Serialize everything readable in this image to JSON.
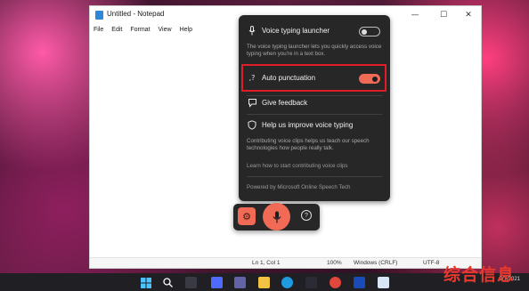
{
  "notepad": {
    "title": "Untitled - Notepad",
    "window_buttons": {
      "minimize": "—",
      "maximize": "☐",
      "close": "✕"
    },
    "menu": [
      "File",
      "Edit",
      "Format",
      "View",
      "Help"
    ],
    "status": {
      "position": "Ln 1, Col 1",
      "zoom": "100%",
      "line_ending": "Windows (CRLF)",
      "encoding": "UTF-8"
    }
  },
  "voice_typing_panel": {
    "launcher": {
      "label": "Voice typing launcher",
      "enabled": false
    },
    "launcher_desc": "The voice typing launcher lets you quickly access voice typing when you're in a text box.",
    "auto_punctuation": {
      "label": "Auto punctuation",
      "enabled": true
    },
    "feedback_label": "Give feedback",
    "improve_label": "Help us improve voice typing",
    "improve_desc": "Contributing voice clips helps us teach our speech technologies how people really talk.",
    "learn_link": "Learn how to start contributing voice clips",
    "powered_by": "Powered by Microsoft Online Speech Tech"
  },
  "voice_bar": {
    "help_label": "?"
  },
  "tray": {
    "date": "9/7/2021"
  },
  "watermark": "综合信息",
  "colors": {
    "accent": "#f06a55",
    "highlight": "#e11d2a",
    "panel": "#272727"
  },
  "icons": [
    "microphone-icon",
    "punctuation-icon",
    "feedback-icon",
    "shield-icon",
    "gear-icon",
    "help-icon",
    "notepad-icon"
  ]
}
